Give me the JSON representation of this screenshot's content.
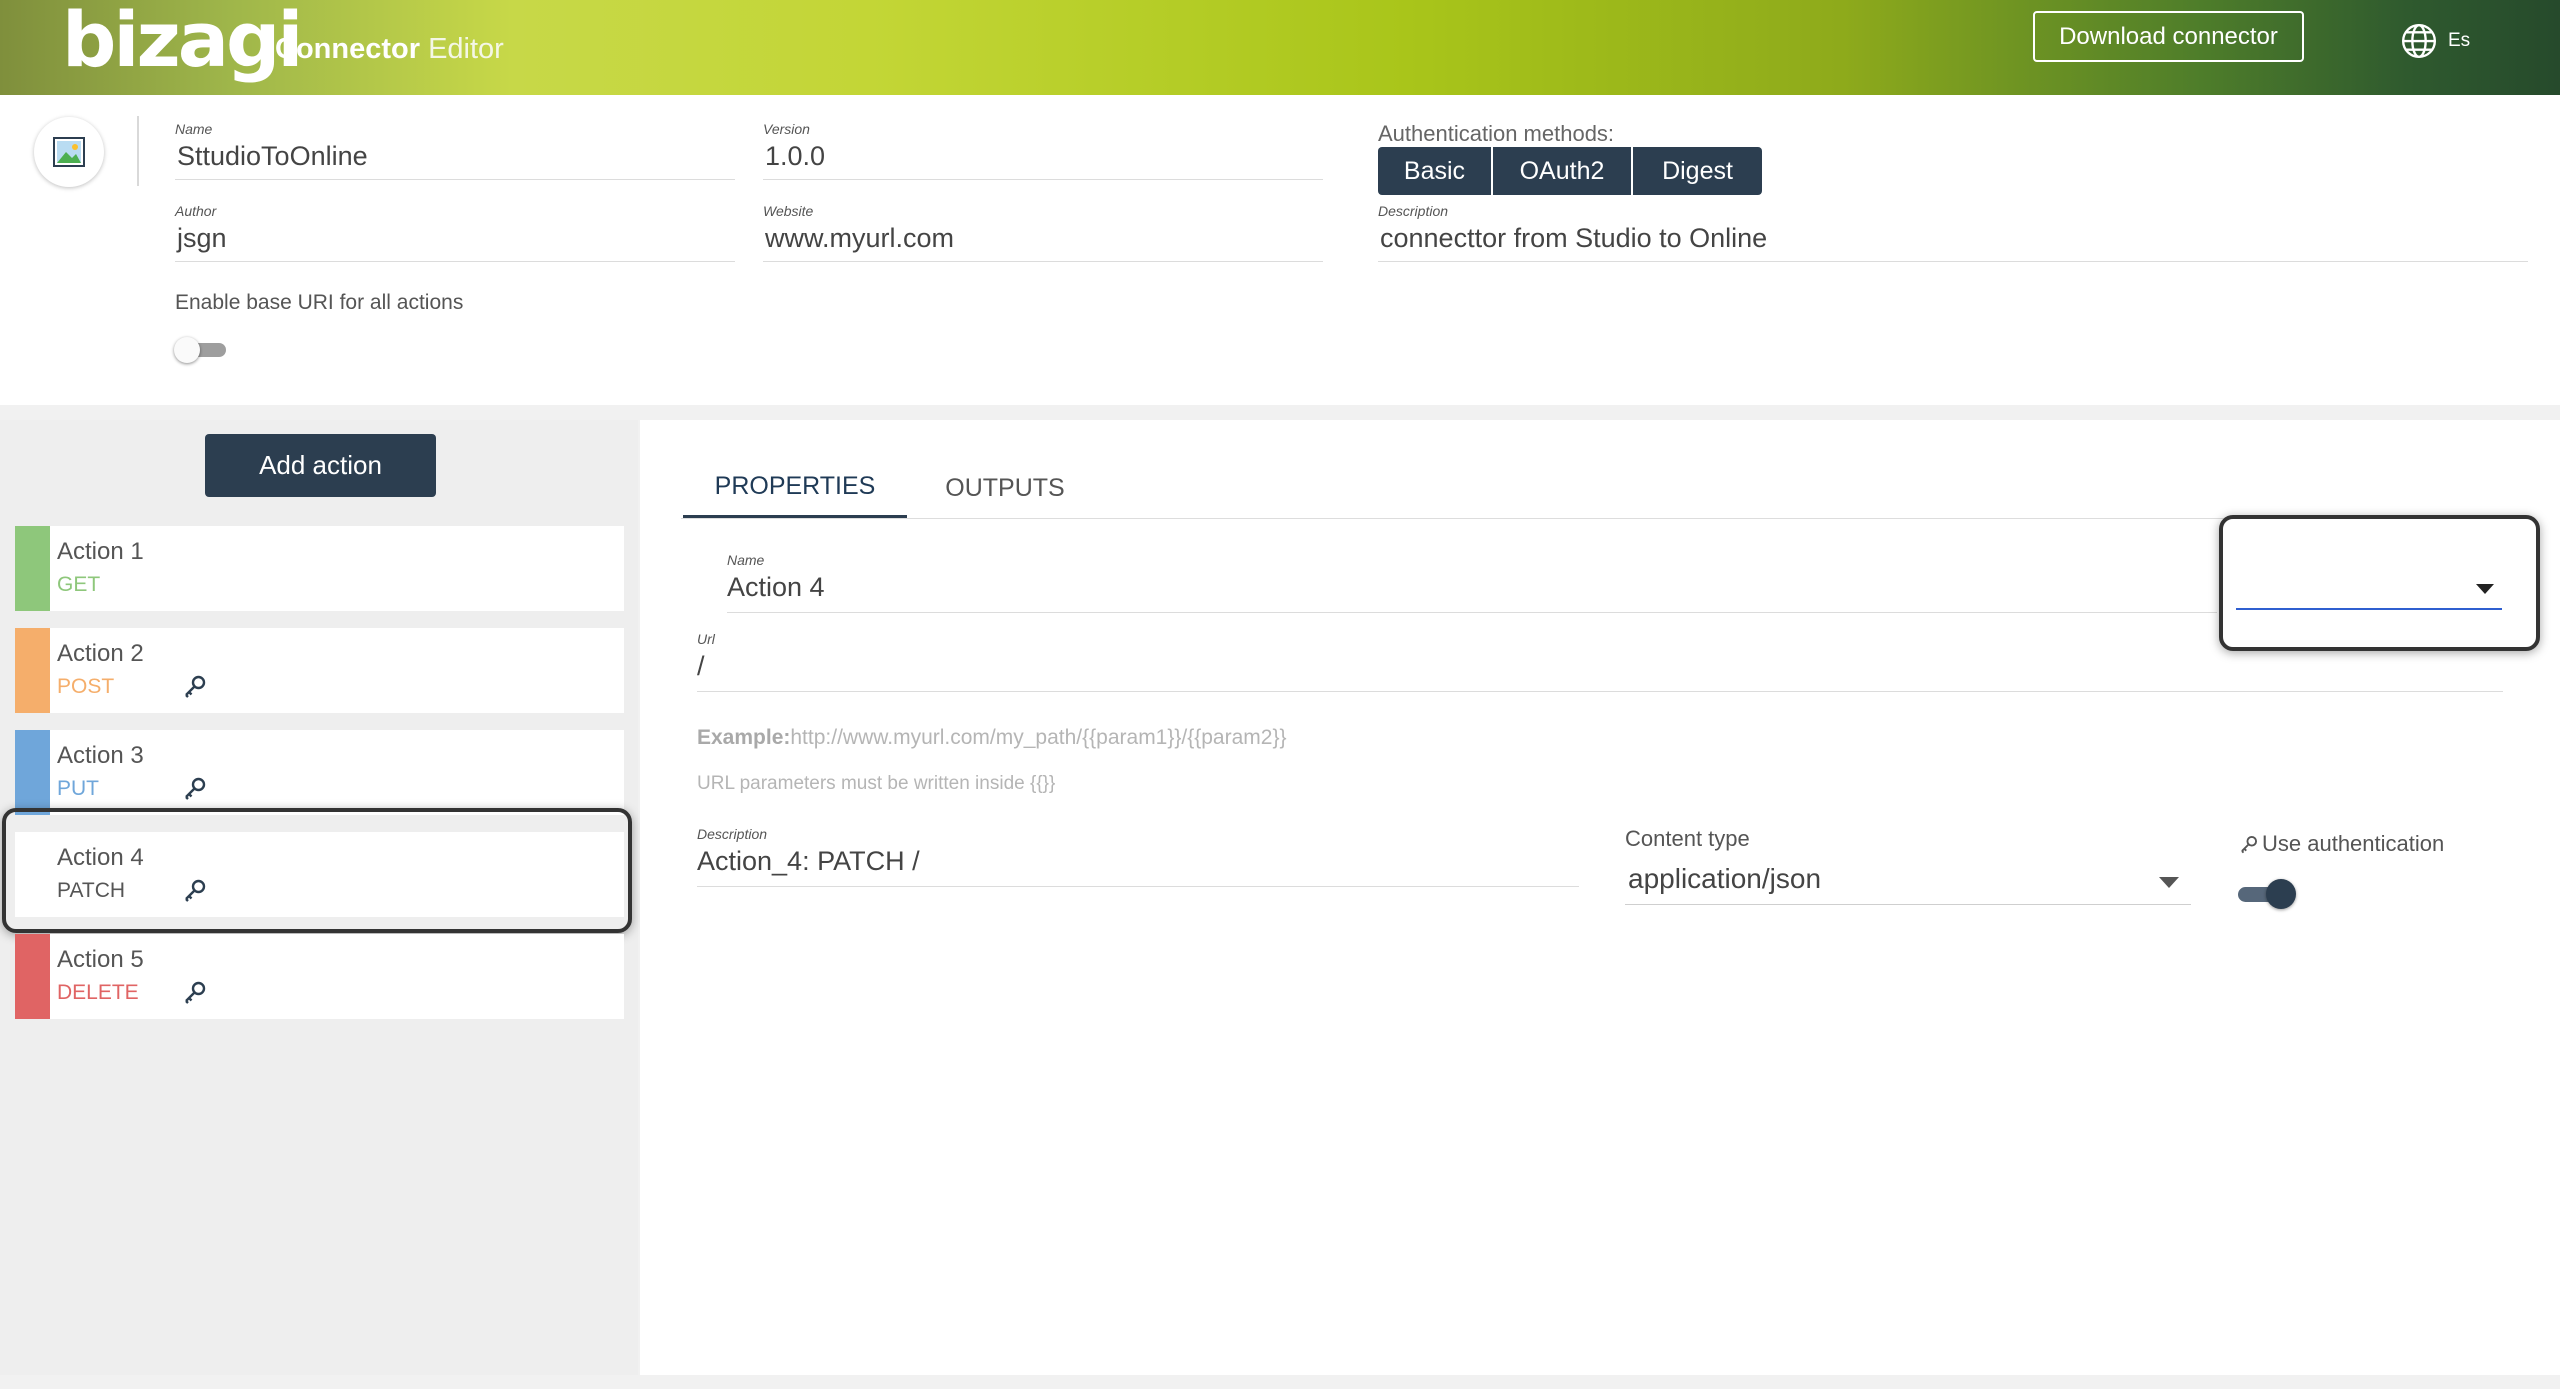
{
  "header": {
    "logo_text": "bizagi",
    "app_title_part1": "Connector",
    "app_title_part2": "Editor",
    "download_label": "Download connector",
    "language": "Es",
    "language_icon": "globe-icon"
  },
  "connector": {
    "image_icon": "image-icon",
    "name_label": "Name",
    "name_value": "SttudioToOnline",
    "version_label": "Version",
    "version_value": "1.0.0",
    "author_label": "Author",
    "author_value": "jsgn",
    "website_label": "Website",
    "website_value": "www.myurl.com",
    "description_label": "Description",
    "description_value": "connecttor from Studio to Online",
    "auth_methods_label": "Authentication methods:",
    "auth_methods": [
      "Basic",
      "OAuth2",
      "Digest"
    ],
    "base_uri_label": "Enable base URI for all actions",
    "base_uri_enabled": false
  },
  "sidebar": {
    "add_action_label": "Add action",
    "actions": [
      {
        "name": "Action 1",
        "method": "GET",
        "color": "#8ec77b",
        "method_color": "#8ec77b",
        "has_auth": false
      },
      {
        "name": "Action 2",
        "method": "POST",
        "color": "#f5ae6b",
        "method_color": "#f5ae6b",
        "has_auth": true
      },
      {
        "name": "Action 3",
        "method": "PUT",
        "color": "#6fa6da",
        "method_color": "#6fa6da",
        "has_auth": true
      },
      {
        "name": "Action 4",
        "method": "PATCH",
        "color": "#ffffff",
        "method_color": "#555555",
        "has_auth": true,
        "selected": true
      },
      {
        "name": "Action 5",
        "method": "DELETE",
        "color": "#e06464",
        "method_color": "#e06464",
        "has_auth": true
      }
    ]
  },
  "main": {
    "tabs": [
      {
        "label": "PROPERTIES",
        "active": true
      },
      {
        "label": "OUTPUTS",
        "active": false
      }
    ],
    "name_label": "Name",
    "name_value": "Action 4",
    "url_label": "Url",
    "url_value": "/",
    "example_prefix": "Example:",
    "example_url": "http://www.myurl.com/my_path/{{param1}}/{{param2}}",
    "url_hint": "URL parameters must be written inside {{}}",
    "description_label": "Description",
    "description_value": "Action_4: PATCH /",
    "content_type_label": "Content type",
    "content_type_value": "application/json",
    "use_auth_label": "Use authentication",
    "use_auth_enabled": true,
    "method_dropdown_value": ""
  },
  "colors": {
    "primary_dark": "#2c3e50",
    "focus_blue": "#2f5fd0"
  }
}
